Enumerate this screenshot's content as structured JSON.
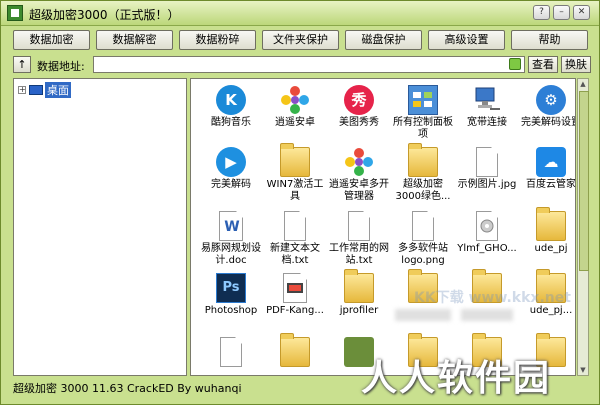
{
  "window": {
    "title": "超级加密3000（正式版！）",
    "controls": [
      "?",
      "–",
      "□",
      "✕"
    ]
  },
  "toolbar": {
    "buttons": [
      "数据加密",
      "数据解密",
      "数据粉碎",
      "文件夹保护",
      "磁盘保护",
      "高级设置",
      "帮助"
    ]
  },
  "address_bar": {
    "up": "↑",
    "label": "数据地址:",
    "value": "",
    "view_label": "查看",
    "switch_label": "换肤"
  },
  "tree": {
    "expander": "+",
    "root": "桌面"
  },
  "files": [
    {
      "label": "酷狗音乐",
      "icon": "kugou-icon"
    },
    {
      "label": "逍遥安卓",
      "icon": "xiaoyao-icon"
    },
    {
      "label": "美图秀秀",
      "icon": "meitu-icon"
    },
    {
      "label": "所有控制面板项",
      "icon": "control-panel-icon"
    },
    {
      "label": "宽带连接",
      "icon": "network-icon"
    },
    {
      "label": "完美解码设置",
      "icon": "settings-icon"
    },
    {
      "label": "完美解码",
      "icon": "player-icon"
    },
    {
      "label": "WIN7激活工具",
      "icon": "folder-icon"
    },
    {
      "label": "逍遥安卓多开管理器",
      "icon": "xiaoyao-icon"
    },
    {
      "label": "超级加密3000绿色...",
      "icon": "folder-icon"
    },
    {
      "label": "示例图片.jpg",
      "icon": "file-icon"
    },
    {
      "label": "百度云管家",
      "icon": "baidu-cloud-icon"
    },
    {
      "label": "易豚网规划设计.doc",
      "icon": "word-icon"
    },
    {
      "label": "新建文本文档.txt",
      "icon": "text-file-icon"
    },
    {
      "label": "工作常用的网站.txt",
      "icon": "text-file-icon"
    },
    {
      "label": "多多软件站logo.png",
      "icon": "image-file-icon"
    },
    {
      "label": "Ylmf_GHO...",
      "icon": "disc-image-icon"
    },
    {
      "label": "ude_pj",
      "icon": "folder-icon"
    },
    {
      "label": "Photoshop",
      "icon": "photoshop-icon"
    },
    {
      "label": "PDF-Kang...",
      "icon": "pdf-icon"
    },
    {
      "label": "jprofiler",
      "icon": "folder-icon"
    },
    {
      "label": "",
      "icon": "folder-icon"
    },
    {
      "label": "",
      "icon": "folder-icon"
    },
    {
      "label": "ude_pj...",
      "icon": "folder-icon"
    },
    {
      "label": "",
      "icon": "installer-icon"
    },
    {
      "label": "",
      "icon": "folder-icon"
    },
    {
      "label": "",
      "icon": "android-icon"
    },
    {
      "label": "",
      "icon": "folder-icon"
    },
    {
      "label": "",
      "icon": "folder-icon"
    },
    {
      "label": "",
      "icon": "folder-icon"
    }
  ],
  "watermarks": {
    "center": "KK下载 www.kkx.net",
    "corner": "人人软件园"
  },
  "status": "超级加密 3000 11.63  CrackED By wuhanqi",
  "colors": {
    "window_bg": "#c9e08f",
    "selection": "#316ac5"
  }
}
